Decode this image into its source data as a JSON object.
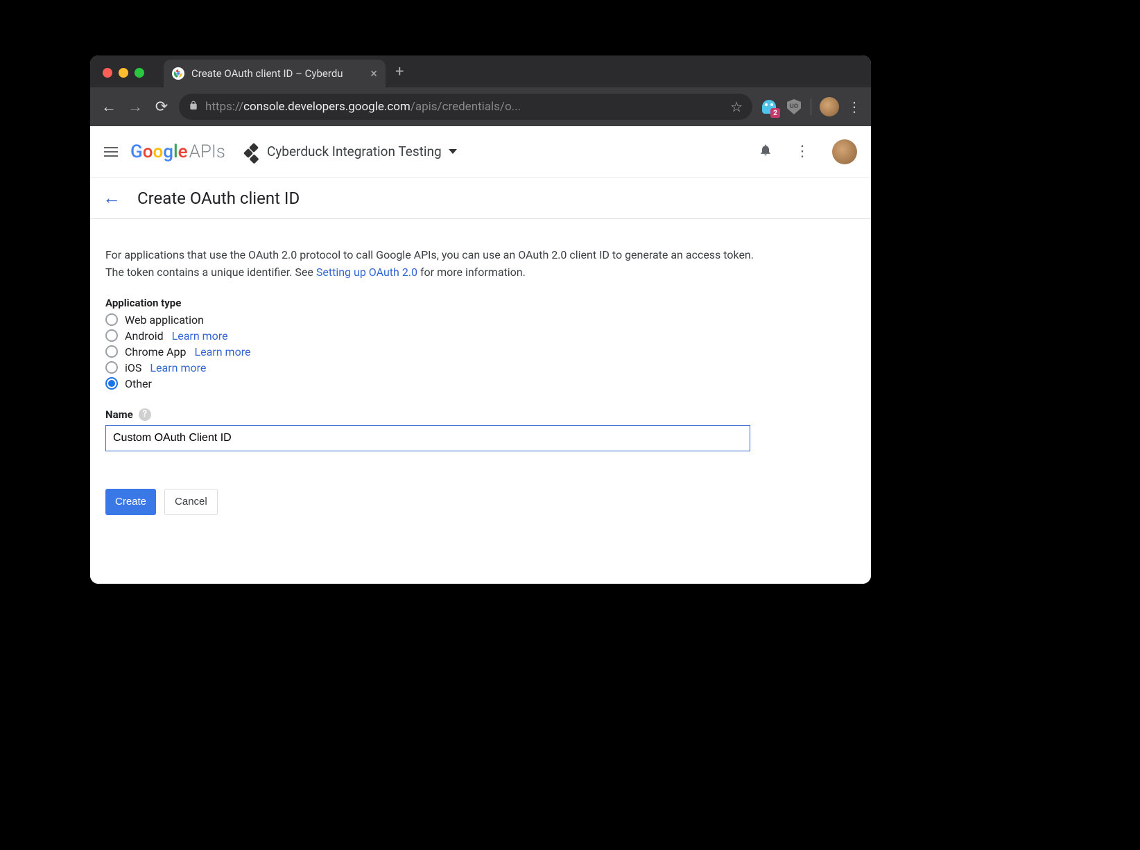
{
  "browser": {
    "tab_title": "Create OAuth client ID – Cyberdu",
    "url_proto": "https://",
    "url_host": "console.developers.google.com",
    "url_path": "/apis/credentials/o...",
    "ext_badge": "2",
    "shield_label": "UO"
  },
  "header": {
    "logo_apis": "APIs",
    "project_name": "Cyberduck Integration Testing"
  },
  "page": {
    "title": "Create OAuth client ID",
    "intro_1": "For applications that use the OAuth 2.0 protocol to call Google APIs, you can use an OAuth 2.0 client ID to generate an access token. The token contains a unique identifier. See ",
    "intro_link": "Setting up OAuth 2.0",
    "intro_2": " for more information.",
    "app_type_label": "Application type",
    "radios": {
      "web": "Web application",
      "android": "Android",
      "chrome": "Chrome App",
      "ios": "iOS",
      "other": "Other"
    },
    "learn_more": "Learn more",
    "name_label": "Name",
    "name_value": "Custom OAuth Client ID",
    "create_label": "Create",
    "cancel_label": "Cancel"
  }
}
